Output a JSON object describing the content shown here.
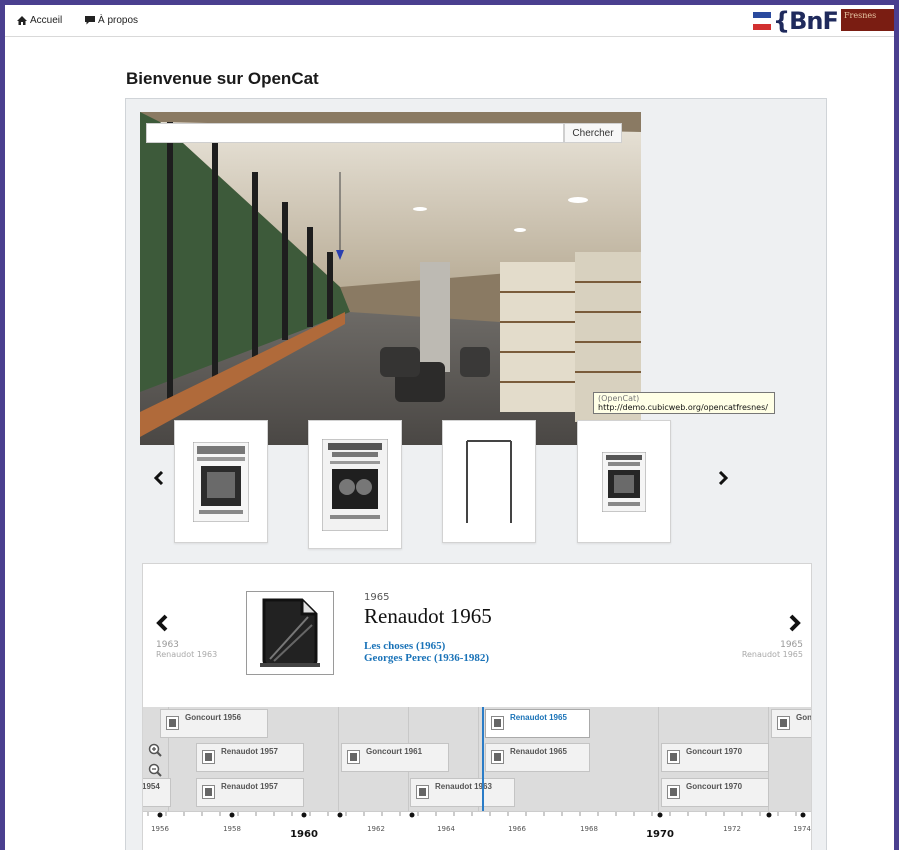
{
  "nav": {
    "home": "Accueil",
    "about": "À propos"
  },
  "logos": {
    "bnf": "{BnF",
    "fresnes": "Fresnes"
  },
  "page_title": "Bienvenue sur OpenCat",
  "search": {
    "button": "Chercher",
    "value": ""
  },
  "tooltip": {
    "line1": "(OpenCat)",
    "url": "http://demo.cubicweb.org/opencatfresnes/"
  },
  "carousel": {
    "prev_icon": "chevron-left-icon",
    "next_icon": "chevron-right-icon",
    "items": [
      {
        "label": "book-cover-1"
      },
      {
        "label": "book-cover-2"
      },
      {
        "label": "book-cover-3"
      },
      {
        "label": "book-cover-4"
      }
    ]
  },
  "timeline": {
    "slide": {
      "year": "1965",
      "title": "Renaudot 1965",
      "link1": "Les choses (1965)",
      "link2": "Georges Perec (1936-1982)"
    },
    "prev": {
      "year": "1963",
      "label": "Renaudot 1963"
    },
    "next": {
      "year": "1965",
      "label": "Renaudot 1965"
    },
    "markers": {
      "m1": "Goncourt 1956",
      "m2": "Renaudot 1957",
      "m3": "Renaudot 1957",
      "m4": "Goncourt 1961",
      "m5": "Renaudot 1963",
      "m6": "Renaudot 1965",
      "m7": "Renaudot 1965",
      "m8": "Goncourt 1970",
      "m9": "Goncourt 1970",
      "m10": "Gonc",
      "m11": "1954"
    },
    "axis": {
      "t1": "1956",
      "t2": "1958",
      "t3": "1960",
      "t4": "1962",
      "t5": "1964",
      "t6": "1966",
      "t7": "1968",
      "t8": "1970",
      "t9": "1972",
      "t10": "1974"
    }
  },
  "colors": {
    "frame": "#4a3f8f",
    "link": "#1a73b8",
    "bnf_red": "#7a1d12"
  }
}
